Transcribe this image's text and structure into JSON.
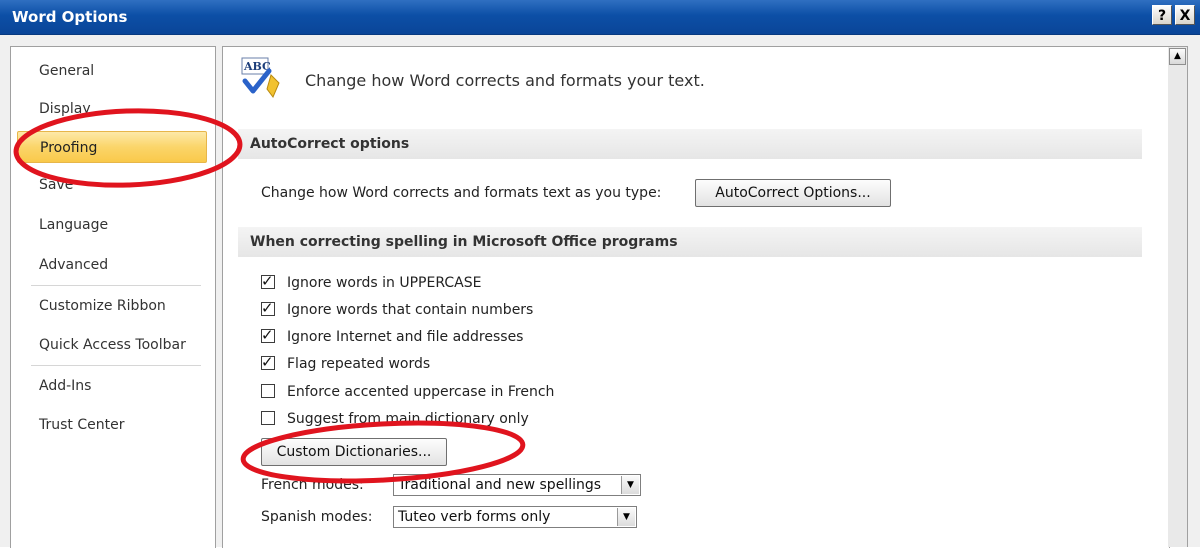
{
  "window": {
    "title": "Word Options",
    "help_label": "?",
    "close_label": "X"
  },
  "nav": {
    "items": [
      {
        "label": "General"
      },
      {
        "label": "Display"
      },
      {
        "label": "Proofing",
        "selected": true
      },
      {
        "label": "Save"
      },
      {
        "label": "Language"
      },
      {
        "label": "Advanced"
      },
      {
        "label": "Customize Ribbon"
      },
      {
        "label": "Quick Access Toolbar"
      },
      {
        "label": "Add-Ins"
      },
      {
        "label": "Trust Center"
      }
    ]
  },
  "main": {
    "header_icon": "abc-spellcheck-icon",
    "header_text": "Change how Word corrects and formats your text.",
    "autocorrect": {
      "section_title": "AutoCorrect options",
      "description": "Change how Word corrects and formats text as you type:",
      "button_label": "AutoCorrect Options..."
    },
    "spelling": {
      "section_title": "When correcting spelling in Microsoft Office programs",
      "options": [
        {
          "label": "Ignore words in UPPERCASE",
          "checked": true
        },
        {
          "label": "Ignore words that contain numbers",
          "checked": true
        },
        {
          "label": "Ignore Internet and file addresses",
          "checked": true
        },
        {
          "label": "Flag repeated words",
          "checked": true
        },
        {
          "label": "Enforce accented uppercase in French",
          "checked": false
        },
        {
          "label": "Suggest from main dictionary only",
          "checked": false
        }
      ],
      "custom_dictionaries_label": "Custom Dictionaries...",
      "french_modes_label": "French modes:",
      "french_modes_value": "Traditional and new spellings",
      "spanish_modes_label": "Spanish modes:",
      "spanish_modes_value": "Tuteo verb forms only"
    }
  },
  "colors": {
    "titlebar": "#0c4fa6",
    "selected_nav": "#fbd56a",
    "annotation": "#e0141e"
  }
}
